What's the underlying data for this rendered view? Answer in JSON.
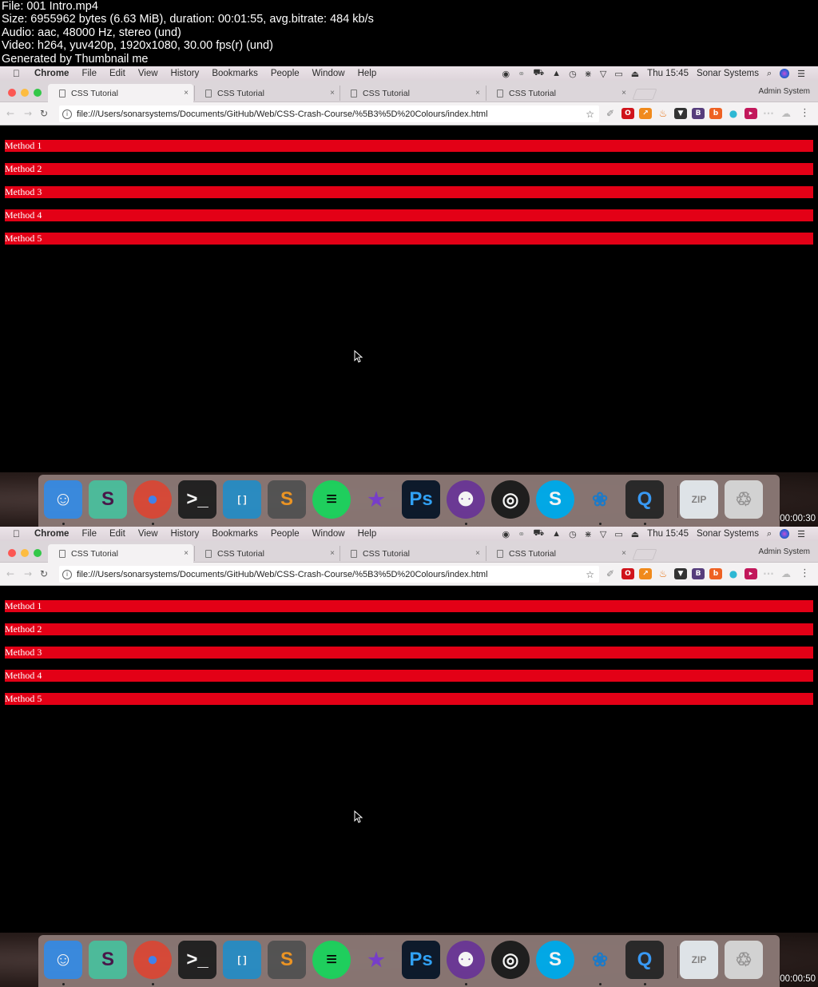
{
  "info": {
    "file": "File: 001 Intro.mp4",
    "size": "Size: 6955962 bytes (6.63 MiB), duration: 00:01:55, avg.bitrate: 484 kb/s",
    "audio": "Audio: aac, 48000 Hz, stereo (und)",
    "video": "Video: h264, yuv420p, 1920x1080, 30.00 fps(r) (und)",
    "generator": "Generated by Thumbnail me"
  },
  "frames": [
    {
      "timestamp": "00:00:30"
    },
    {
      "timestamp": "00:00:50"
    }
  ],
  "menubar": {
    "apple_icon": "",
    "items": [
      "Chrome",
      "File",
      "Edit",
      "View",
      "History",
      "Bookmarks",
      "People",
      "Window",
      "Help"
    ],
    "status_icons": [
      "record-icon",
      "creative-cloud-icon",
      "truck-icon",
      "google-drive-icon",
      "time-machine-icon",
      "bluetooth-icon",
      "wifi-icon",
      "airplay-icon",
      "eject-icon"
    ],
    "clock": "Thu 15:45",
    "user": "Sonar Systems",
    "search_icon": "⌕",
    "list_icon": "☰"
  },
  "browser": {
    "tabs": [
      {
        "title": "CSS Tutorial",
        "active": true
      },
      {
        "title": "CSS Tutorial",
        "active": false
      },
      {
        "title": "CSS Tutorial",
        "active": false
      },
      {
        "title": "CSS Tutorial",
        "active": false
      }
    ],
    "close_glyph": "×",
    "profile": "Admin System",
    "back": "←",
    "forward": "→",
    "reload": "↻",
    "url": "file:///Users/sonarsystems/Documents/GitHub/Web/CSS-Crash-Course/%5B3%5D%20Colours/index.html",
    "star": "☆",
    "extensions": [
      {
        "name": "eyedropper",
        "glyph": "✐",
        "color": "#888888"
      },
      {
        "name": "opera",
        "glyph": "O",
        "color": "#d0131b"
      },
      {
        "name": "analytics",
        "glyph": "↗",
        "color": "#f08a1c"
      },
      {
        "name": "fire",
        "glyph": "♨",
        "color": "#e6761a"
      },
      {
        "name": "ghostery",
        "glyph": "▼",
        "color": "#333333"
      },
      {
        "name": "bootstrap",
        "glyph": "B",
        "color": "#563d7c"
      },
      {
        "name": "bitly",
        "glyph": "b",
        "color": "#ee6123"
      },
      {
        "name": "droplet",
        "glyph": "●",
        "color": "#2eb8d4"
      },
      {
        "name": "fastforward",
        "glyph": "▸",
        "color": "#c2185b"
      },
      {
        "name": "more",
        "glyph": "···",
        "color": "#cccccc"
      },
      {
        "name": "cloud",
        "glyph": "☁",
        "color": "#bbbbbb"
      }
    ],
    "menu_dots": "⋮"
  },
  "page": {
    "methods": [
      "Method 1",
      "Method 2",
      "Method 3",
      "Method 4",
      "Method 5"
    ],
    "bar_color": "#e30016"
  },
  "dock": {
    "apps": [
      {
        "name": "finder",
        "label": "☺",
        "bg": "#3a8ee6",
        "fg": "#ffffff",
        "running": true
      },
      {
        "name": "slack",
        "label": "S",
        "bg": "#4ec2a0",
        "fg": "#4a154b",
        "running": false
      },
      {
        "name": "chrome",
        "label": "●",
        "bg": "#dd4b39",
        "fg": "#4285f4",
        "running": true
      },
      {
        "name": "terminal",
        "label": ">_",
        "bg": "#222222",
        "fg": "#ffffff",
        "running": false
      },
      {
        "name": "brackets",
        "label": "[ ]",
        "bg": "#2a90c8",
        "fg": "#ffffff",
        "running": false
      },
      {
        "name": "sublime-text",
        "label": "S",
        "bg": "#555555",
        "fg": "#f59a23",
        "running": false
      },
      {
        "name": "spotify",
        "label": "≡",
        "bg": "#1ed760",
        "fg": "#000000",
        "running": false
      },
      {
        "name": "imovie",
        "label": "★",
        "bg": "transparent",
        "fg": "#7b3fd1",
        "running": false
      },
      {
        "name": "photoshop",
        "label": "Ps",
        "bg": "#0c1a2c",
        "fg": "#31a8ff",
        "running": false
      },
      {
        "name": "github-desktop",
        "label": "⚉",
        "bg": "#6e3a9a",
        "fg": "#ffffff",
        "running": true
      },
      {
        "name": "obs",
        "label": "◎",
        "bg": "#1e1e1e",
        "fg": "#ffffff",
        "running": false
      },
      {
        "name": "skype",
        "label": "S",
        "bg": "#00aff0",
        "fg": "#ffffff",
        "running": false
      },
      {
        "name": "paw",
        "label": "❀",
        "bg": "transparent",
        "fg": "#1e7fcf",
        "running": true
      },
      {
        "name": "quicktime",
        "label": "Q",
        "bg": "#2a2a2a",
        "fg": "#3aa0ff",
        "running": true
      },
      {
        "name": "zip-file",
        "label": "ZIP",
        "bg": "#e8eef2",
        "fg": "#888888",
        "running": false
      },
      {
        "name": "trash",
        "label": "♲",
        "bg": "#dcdcdc",
        "fg": "#999999",
        "running": false
      }
    ]
  }
}
